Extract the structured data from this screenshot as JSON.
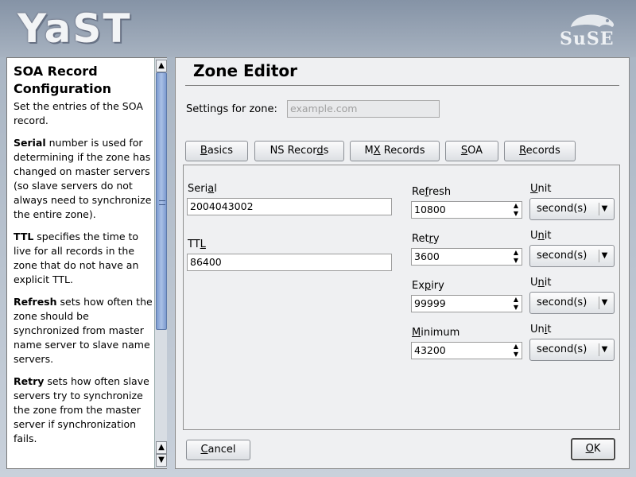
{
  "branding": {
    "app_logo": "YaST",
    "vendor_logo": "suse"
  },
  "help": {
    "title": "SOA Record Configuration",
    "intro": "Set the entries of the SOA record.",
    "items": [
      {
        "term": "Serial",
        "text": " number is used for determining if the zone has changed on master servers (so slave servers do not always need to synchronize the entire zone)."
      },
      {
        "term": "TTL",
        "text": " specifies the time to live for all records in the zone that do not have an explicit TTL."
      },
      {
        "term": "Refresh",
        "text": " sets how often the zone should be synchronized from master name server to slave name servers."
      },
      {
        "term": "Retry",
        "text": " sets how often slave servers try to synchronize the zone from the master server if synchronization fails."
      }
    ]
  },
  "main": {
    "title": "Zone Editor",
    "zone_label": "Settings for zone:",
    "zone_placeholder": "example.com",
    "tabs": [
      {
        "pre": "",
        "key": "B",
        "post": "asics"
      },
      {
        "pre": "NS Recor",
        "key": "d",
        "post": "s"
      },
      {
        "pre": "M",
        "key": "X",
        "post": " Records"
      },
      {
        "pre": "",
        "key": "S",
        "post": "OA"
      },
      {
        "pre": "",
        "key": "R",
        "post": "ecords"
      }
    ],
    "serial": {
      "label_pre": "Seri",
      "label_key": "a",
      "label_post": "l",
      "value": "2004043002"
    },
    "ttl": {
      "label_pre": "TT",
      "label_key": "L",
      "label_post": "",
      "value": "86400"
    },
    "timers": [
      {
        "label_pre": "Re",
        "label_key": "f",
        "label_post": "resh",
        "value": "10800",
        "unit_label_pre": "",
        "unit_label_key": "U",
        "unit_label_post": "nit",
        "unit": "second(s)"
      },
      {
        "label_pre": "Ret",
        "label_key": "r",
        "label_post": "y",
        "value": "3600",
        "unit_label_pre": "U",
        "unit_label_key": "n",
        "unit_label_post": "it",
        "unit": "second(s)"
      },
      {
        "label_pre": "Ex",
        "label_key": "p",
        "label_post": "iry",
        "value": "99999",
        "unit_label_pre": "U",
        "unit_label_key": "n",
        "unit_label_post": "it",
        "unit": "second(s)"
      },
      {
        "label_pre": "",
        "label_key": "M",
        "label_post": "inimum",
        "value": "43200",
        "unit_label_pre": "Un",
        "unit_label_key": "i",
        "unit_label_post": "t",
        "unit": "second(s)"
      }
    ],
    "cancel": {
      "pre": "",
      "key": "C",
      "post": "ancel"
    },
    "ok": {
      "pre": "",
      "key": "O",
      "post": "K"
    }
  }
}
